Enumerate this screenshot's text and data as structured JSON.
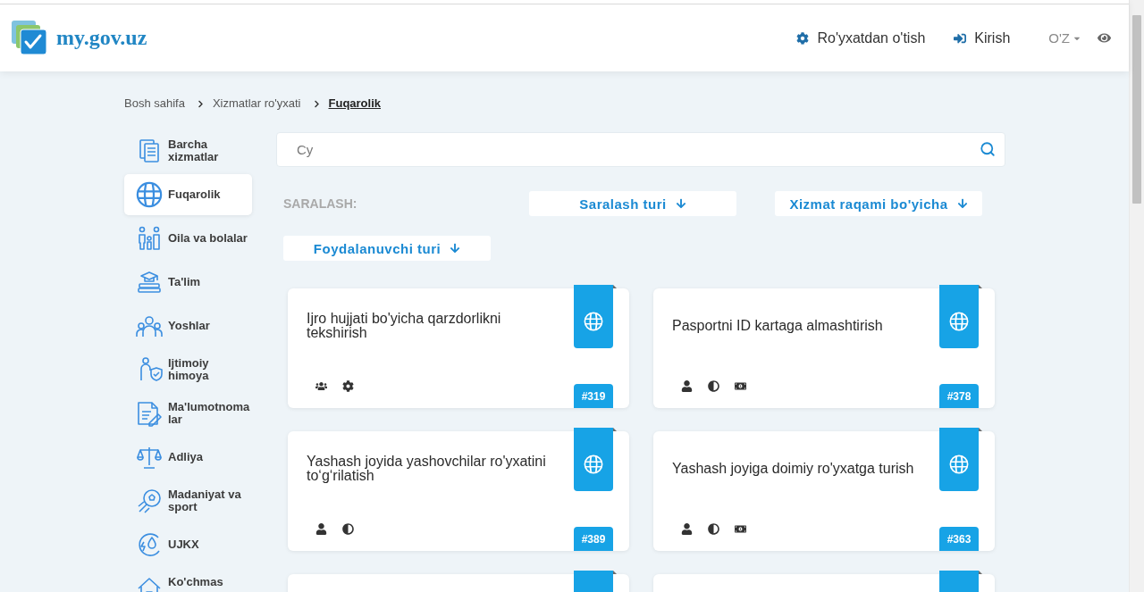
{
  "header": {
    "logo_text": "my.gov.uz",
    "links": [
      "Ro'yxatdan o'tish",
      "Kirish"
    ],
    "language": "O'Z"
  },
  "breadcrumb": [
    {
      "label": "Bosh sahifa",
      "current": false
    },
    {
      "label": "Xizmatlar ro'yxati",
      "current": false
    },
    {
      "label": "Fuqarolik",
      "current": true
    }
  ],
  "sidebar": {
    "items": [
      {
        "label": "Barcha xizmatlar",
        "selected": false
      },
      {
        "label": "Fuqarolik",
        "selected": true
      },
      {
        "label": "Oila va bolalar",
        "selected": false
      },
      {
        "label": "Ta'lim",
        "selected": false
      },
      {
        "label": "Yoshlar",
        "selected": false
      },
      {
        "label": "Ijtimoiy himoya",
        "selected": false
      },
      {
        "label": "Ma'lumotnomalar",
        "selected": false
      },
      {
        "label": "Adliya",
        "selected": false
      },
      {
        "label": "Madaniyat va sport",
        "selected": false
      },
      {
        "label": "UJKX",
        "selected": false
      },
      {
        "label": "Ko'chmas",
        "selected": false
      }
    ]
  },
  "search": {
    "value": "Cy"
  },
  "sorting": {
    "label": "SARALASH:",
    "buttons": [
      "Saralash turi",
      "Xizmat raqami bo'yicha",
      "Foydalanuvchi turi"
    ]
  },
  "cards": [
    {
      "kind": "service",
      "title": "Ijro hujjati bo'yicha qarzdorlikni tekshirish",
      "number": "#319",
      "features": [
        {
          "kind": "group"
        },
        {
          "kind": "settings"
        }
      ]
    },
    {
      "kind": "service",
      "title": "Pasportni ID kartaga almashtirish",
      "number": "#378",
      "features": [
        {
          "kind": "person"
        },
        {
          "kind": "contrast"
        },
        {
          "kind": "money"
        }
      ]
    },
    {
      "kind": "service",
      "title": "Yashash joyida yashovchilar ro'yxatini to‘g‘rilatish",
      "number": "#389",
      "features": [
        {
          "kind": "person"
        },
        {
          "kind": "contrast"
        }
      ]
    },
    {
      "kind": "service",
      "title": "Yashash joyiga doimiy ro'yxatga turish",
      "number": "#363",
      "features": [
        {
          "kind": "person"
        },
        {
          "kind": "contrast"
        },
        {
          "kind": "money"
        }
      ]
    },
    {
      "kind": "partial"
    },
    {
      "kind": "partial"
    }
  ]
}
